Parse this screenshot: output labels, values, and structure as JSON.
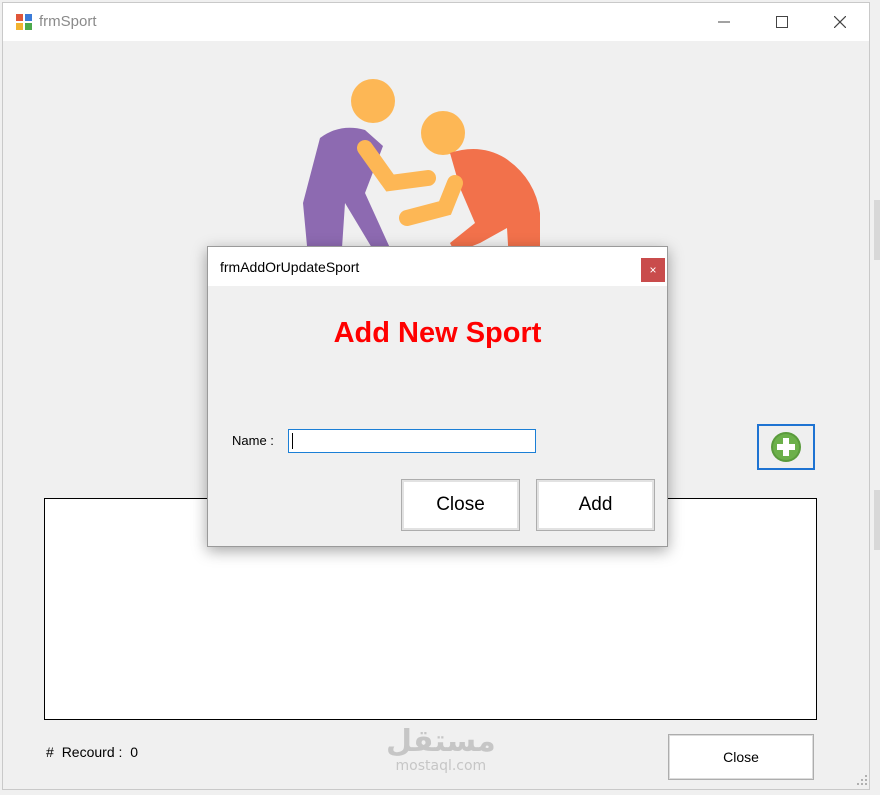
{
  "main_window": {
    "title": "frmSport",
    "controls": {
      "minimize_icon": "minimize-icon",
      "maximize_icon": "maximize-icon",
      "close_icon": "close-icon"
    },
    "records_hash": "#",
    "records_label": "Recourd :",
    "records_count": "0",
    "close_label": "Close",
    "add_icon": "plus-circle-icon"
  },
  "dialog": {
    "title": "frmAddOrUpdateSport",
    "close_glyph": "×",
    "heading": "Add New Sport",
    "name_label": "Name :",
    "name_value": "",
    "close_label": "Close",
    "add_label": "Add"
  },
  "watermark": {
    "arabic": "مستقل",
    "latin": "mostaql.com"
  },
  "colors": {
    "heading_red": "#ff0000",
    "dialog_close_bg": "#c94c4c",
    "focus_blue": "#1e73d2",
    "wrestler_purple": "#8d6ab1",
    "wrestler_orange": "#f2714b",
    "skin": "#fdb755",
    "add_icon_green": "#5a9b3c"
  }
}
